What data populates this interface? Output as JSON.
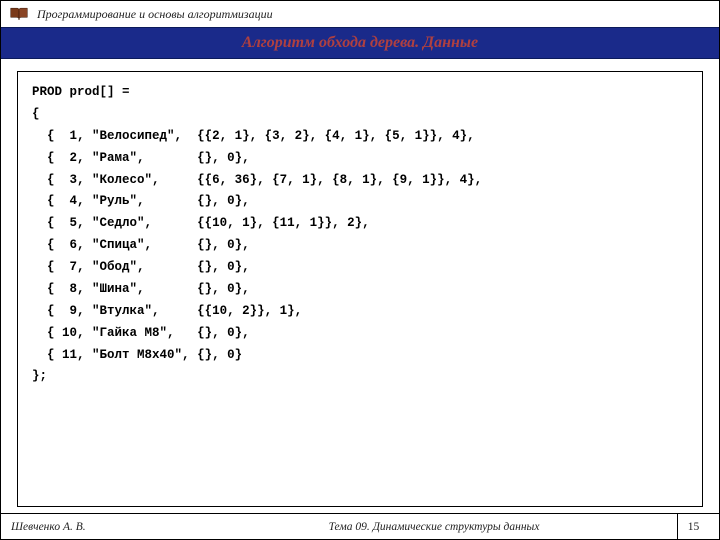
{
  "header": {
    "course_title": "Программирование и основы алгоритмизации",
    "icon_name": "book-icon"
  },
  "slide_title": "Алгоритм обхода дерева. Данные",
  "code": {
    "decl": "PROD prod[] =",
    "open": "{",
    "close": "};",
    "row_prefix": "  { ",
    "row_prefix_wide": "  {",
    "rows": [
      {
        "id": " 1, ",
        "name": "\"Велосипед\",  ",
        "rest": "{{2, 1}, {3, 2}, {4, 1}, {5, 1}}, 4},"
      },
      {
        "id": " 2, ",
        "name": "\"Рама\",       ",
        "rest": "{}, 0},"
      },
      {
        "id": " 3, ",
        "name": "\"Колесо\",     ",
        "rest": "{{6, 36}, {7, 1}, {8, 1}, {9, 1}}, 4},"
      },
      {
        "id": " 4, ",
        "name": "\"Руль\",       ",
        "rest": "{}, 0},"
      },
      {
        "id": " 5, ",
        "name": "\"Седло\",      ",
        "rest": "{{10, 1}, {11, 1}}, 2},"
      },
      {
        "id": " 6, ",
        "name": "\"Спица\",      ",
        "rest": "{}, 0},"
      },
      {
        "id": " 7, ",
        "name": "\"Обод\",       ",
        "rest": "{}, 0},"
      },
      {
        "id": " 8, ",
        "name": "\"Шина\",       ",
        "rest": "{}, 0},"
      },
      {
        "id": " 9, ",
        "name": "\"Втулка\",     ",
        "rest": "{{10, 2}}, 1},"
      },
      {
        "id": "10, ",
        "name": "\"Гайка М8\",   ",
        "rest": "{}, 0},"
      },
      {
        "id": "11, ",
        "name": "\"Болт М8х40\", ",
        "rest": "{}, 0}"
      }
    ]
  },
  "footer": {
    "author": "Шевченко А. В.",
    "topic": "Тема 09. Динамические структуры данных",
    "page": "15"
  }
}
